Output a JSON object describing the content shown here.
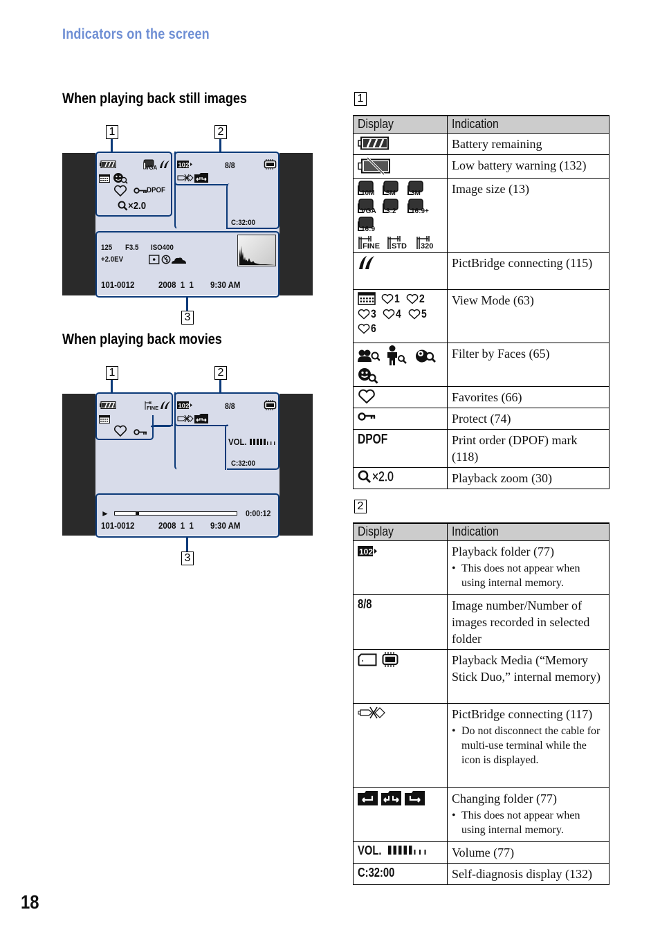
{
  "header": {
    "section_title": "Indicators on the screen"
  },
  "page_number": "18",
  "still_images": {
    "heading": "When playing back still images",
    "callouts": [
      "1",
      "2",
      "3"
    ],
    "zone1": {
      "image_size": "VGA",
      "dpof": "DPOF",
      "zoom": "×2.0"
    },
    "zone2": {
      "folder": "102",
      "image_count": "8/8",
      "self_diagnosis": "C:32:00"
    },
    "zone3": {
      "shutter": "125",
      "aperture": "F3.5",
      "iso": "ISO400",
      "exposure": "+2.0EV",
      "file_number": "101-0012",
      "date": "2008  1  1",
      "time": "9:30 AM"
    }
  },
  "movies": {
    "heading": "When playing back movies",
    "callouts": [
      "1",
      "2",
      "3"
    ],
    "zone1": {
      "image_size": "FINE"
    },
    "zone2": {
      "folder": "102",
      "image_count": "8/8",
      "volume_label": "VOL.",
      "volume_level": 5,
      "volume_max": 8,
      "self_diagnosis": "C:32:00"
    },
    "zone3": {
      "play_symbol": "►",
      "progress_fraction": 0.17,
      "elapsed": "0:00:12",
      "file_number": "101-0012",
      "date": "2008  1  1",
      "time": "9:30 AM"
    }
  },
  "table1": {
    "label": "1",
    "headers": [
      "Display",
      "Indication"
    ],
    "rows": [
      {
        "icons": [
          "battery-remaining"
        ],
        "indication": "Battery remaining",
        "notes": []
      },
      {
        "icons": [
          "battery-low"
        ],
        "indication": "Low battery warning (132)",
        "notes": []
      },
      {
        "icons": [
          "10M",
          "5M",
          "3M",
          "VGA",
          "3:2",
          "16:9+",
          "16:9",
          "FINE",
          "STD",
          "320"
        ],
        "indication": "Image size (13)",
        "notes": []
      },
      {
        "icons": [
          "pictbridge"
        ],
        "indication": "PictBridge connecting (115)",
        "notes": []
      },
      {
        "icons": [
          "calendar",
          "♡1",
          "♡2",
          "♡3",
          "♡4",
          "♡5",
          "♡6"
        ],
        "indication": "View Mode (63)",
        "notes": []
      },
      {
        "icons": [
          "faces-group",
          "faces-child",
          "faces-baby",
          "faces-smile"
        ],
        "indication": "Filter by Faces (65)",
        "notes": []
      },
      {
        "icons": [
          "heart"
        ],
        "indication": "Favorites (66)",
        "notes": []
      },
      {
        "icons": [
          "key"
        ],
        "indication": "Protect (74)",
        "notes": []
      },
      {
        "icons": [
          "DPOF"
        ],
        "indication": "Print order (DPOF) mark (118)",
        "notes": []
      },
      {
        "icons": [
          "×2.0"
        ],
        "indication": "Playback zoom (30)",
        "notes": []
      }
    ]
  },
  "table2": {
    "label": "2",
    "headers": [
      "Display",
      "Indication"
    ],
    "rows": [
      {
        "icons": [
          "102"
        ],
        "indication": "Playback folder (77)",
        "notes": [
          "This does not appear when using internal memory."
        ]
      },
      {
        "icons": [
          "8/8"
        ],
        "indication": "Image number/Number of images recorded in selected folder",
        "notes": []
      },
      {
        "icons": [
          "memory-stick",
          "internal-memory"
        ],
        "indication": "Playback Media (“Memory Stick Duo,” internal memory)",
        "notes": []
      },
      {
        "icons": [
          "pictbridge-connecting"
        ],
        "indication": "PictBridge connecting (117)",
        "notes": [
          "Do not disconnect the cable for multi-use terminal while the icon is displayed."
        ]
      },
      {
        "icons": [
          "folder-back",
          "folder-change",
          "folder-forward"
        ],
        "indication": "Changing folder (77)",
        "notes": [
          "This does not appear when using internal memory."
        ]
      },
      {
        "icons": [
          "VOL."
        ],
        "indication": "Volume (77)",
        "notes": []
      },
      {
        "icons": [
          "C:32:00"
        ],
        "indication": "Self-diagnosis display (132)",
        "notes": []
      }
    ]
  },
  "colors": {
    "title_blue": "#6f8fd4",
    "zone_border": "#0c3a79",
    "screen_bg": "#d8dcea",
    "bezel": "#2a2a2a",
    "table_header": "#cccccc"
  }
}
